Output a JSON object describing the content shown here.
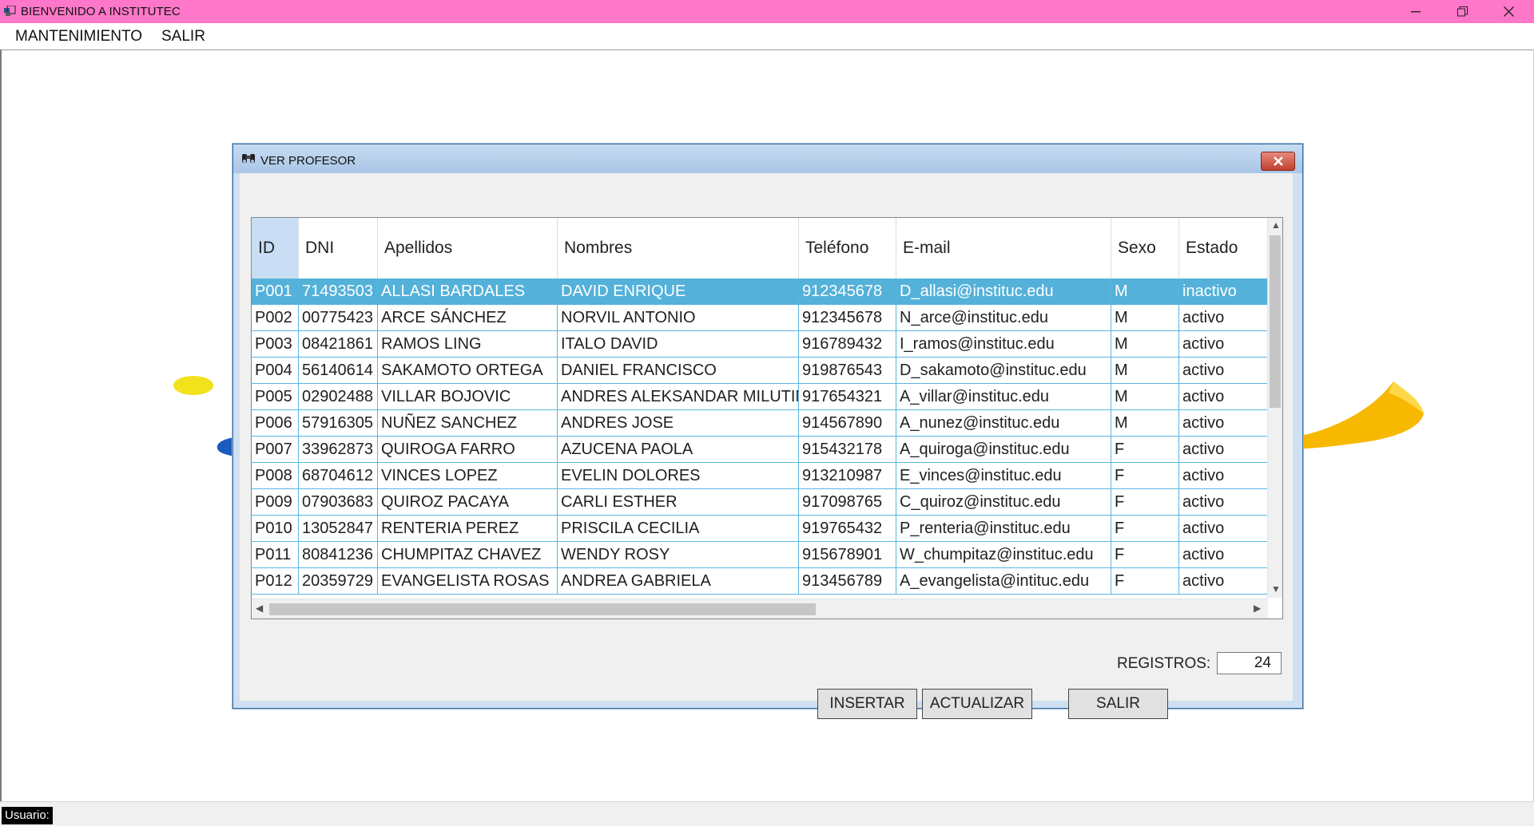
{
  "app": {
    "title": "BIENVENIDO A INSTITUTEC",
    "menu": [
      "MANTENIMIENTO",
      "SALIR"
    ],
    "status_label": "Usuario:"
  },
  "dialog": {
    "title": "VER PROFESOR",
    "close_icon": "close-icon",
    "columns": [
      "ID",
      "DNI",
      "Apellidos",
      "Nombres",
      "Teléfono",
      "E-mail",
      "Sexo",
      "Estado"
    ],
    "rows": [
      [
        "P001",
        "71493503",
        "ALLASI BARDALES",
        "DAVID ENRIQUE",
        "912345678",
        "D_allasi@instituc.edu",
        "M",
        "inactivo"
      ],
      [
        "P002",
        "00775423",
        "ARCE SÁNCHEZ",
        "NORVIL ANTONIO",
        "912345678",
        "N_arce@instituc.edu",
        "M",
        "activo"
      ],
      [
        "P003",
        "08421861",
        "RAMOS LING",
        "ITALO DAVID",
        "916789432",
        "I_ramos@instituc.edu",
        "M",
        "activo"
      ],
      [
        "P004",
        "56140614",
        "SAKAMOTO ORTEGA",
        "DANIEL FRANCISCO",
        "919876543",
        "D_sakamoto@instituc.edu",
        "M",
        "activo"
      ],
      [
        "P005",
        "02902488",
        "VILLAR BOJOVIC",
        "ANDRES ALEKSANDAR MILUTIN",
        "917654321",
        "A_villar@instituc.edu",
        "M",
        "activo"
      ],
      [
        "P006",
        "57916305",
        "NUÑEZ SANCHEZ",
        "ANDRES JOSE",
        "914567890",
        "A_nunez@instituc.edu",
        "M",
        "activo"
      ],
      [
        "P007",
        "33962873",
        "QUIROGA FARRO",
        "AZUCENA PAOLA",
        "915432178",
        "A_quiroga@instituc.edu",
        "F",
        "activo"
      ],
      [
        "P008",
        "68704612",
        "VINCES LOPEZ",
        "EVELIN DOLORES",
        "913210987",
        "E_vinces@instituc.edu",
        "F",
        "activo"
      ],
      [
        "P009",
        "07903683",
        "QUIROZ PACAYA",
        "CARLI ESTHER",
        "917098765",
        "C_quiroz@instituc.edu",
        "F",
        "activo"
      ],
      [
        "P010",
        "13052847",
        "RENTERIA PEREZ",
        "PRISCILA CECILIA",
        "919765432",
        "P_renteria@instituc.edu",
        "F",
        "activo"
      ],
      [
        "P011",
        "80841236",
        "CHUMPITAZ CHAVEZ",
        "WENDY ROSY",
        "915678901",
        "W_chumpitaz@instituc.edu",
        "F",
        "activo"
      ],
      [
        "P012",
        "20359729",
        "EVANGELISTA ROSAS",
        "ANDREA GABRIELA",
        "913456789",
        "A_evangelista@intituc.edu",
        "F",
        "activo"
      ]
    ],
    "selected_row": 0,
    "registros_label": "REGISTROS:",
    "registros_value": "24",
    "buttons": {
      "insertar": "INSERTAR",
      "actualizar": "ACTUALIZAR",
      "salir": "SALIR"
    }
  },
  "colors": {
    "titlebar": "#ff77c8",
    "selection": "#54b1d9",
    "grid_line": "#59b6e0"
  }
}
